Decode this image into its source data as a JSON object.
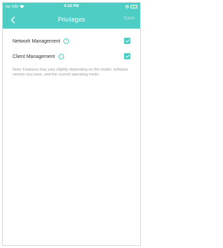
{
  "status_bar": {
    "carrier": "No SIM",
    "time": "5:16 PM"
  },
  "header": {
    "title": "Privileges",
    "save_label": "Save"
  },
  "privileges": [
    {
      "label": "Network Management",
      "info": "i",
      "checked": true
    },
    {
      "label": "Client Management",
      "info": "i",
      "checked": true
    }
  ],
  "note": "Note: Features may vary slightly depending on the model, software version you have, and the current operating mode.",
  "colors": {
    "accent": "#4ecdc4",
    "text": "#333333",
    "note": "#9a9a9a"
  }
}
